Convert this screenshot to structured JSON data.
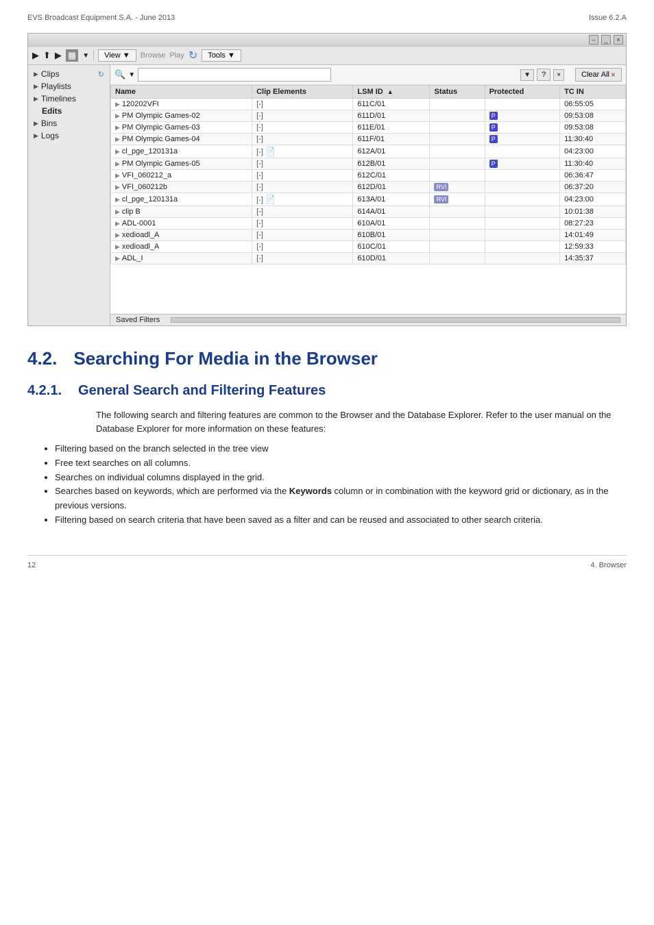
{
  "header": {
    "left": "EVS Broadcast Equipment S.A.  - June 2013",
    "right": "Issue 6.2.A"
  },
  "titleBar": {
    "minimize": "–",
    "restore": "_",
    "close": "×"
  },
  "toolbar": {
    "viewLabel": "View ▼",
    "browseLabel": "Browse",
    "playLabel": "Play",
    "toolsLabel": "Tools ▼",
    "refreshIcon": "↻"
  },
  "sidebar": {
    "items": [
      {
        "label": "Clips",
        "hasArrow": true,
        "icon": "↻",
        "bold": true
      },
      {
        "label": "Playlists",
        "hasArrow": true,
        "bold": true
      },
      {
        "label": "Timelines",
        "hasArrow": true,
        "bold": true
      },
      {
        "label": "Edits",
        "hasArrow": false,
        "indent": true,
        "bold": true
      },
      {
        "label": "Bins",
        "hasArrow": true,
        "bold": true
      },
      {
        "label": "Logs",
        "hasArrow": true,
        "bold": true
      }
    ]
  },
  "searchBar": {
    "placeholder": "",
    "searchIcon": "🔍",
    "dropdownIcon": "▼",
    "helpIcon": "?",
    "clearIcon": "×",
    "clearAllLabel": "Clear All",
    "clearAllIcon": "×"
  },
  "table": {
    "columns": [
      "Name",
      "Clip Elements",
      "LSM ID",
      "Status",
      "Protected",
      "TC IN"
    ],
    "sortCol": "LSM ID",
    "sortDir": "▲",
    "rows": [
      {
        "name": "120202VFI",
        "clipElem": "[-]",
        "lsmId": "611C/01",
        "status": "",
        "protected": "",
        "tcIn": "06:55:05"
      },
      {
        "name": "PM Olympic Games-02",
        "clipElem": "[-]",
        "lsmId": "611D/01",
        "status": "",
        "protected": "P",
        "tcIn": "09:53:08"
      },
      {
        "name": "PM Olympic Games-03",
        "clipElem": "[-]",
        "lsmId": "611E/01",
        "status": "",
        "protected": "P",
        "tcIn": "09:53:08"
      },
      {
        "name": "PM Olympic Games-04",
        "clipElem": "[-]",
        "lsmId": "611F/01",
        "status": "",
        "protected": "P",
        "tcIn": "11:30:40"
      },
      {
        "name": "cl_pge_120131a",
        "clipElem": "[-]",
        "lsmId": "612A/01",
        "status": "",
        "protected": "",
        "tcIn": "04:23:00",
        "hasFileIcon": true
      },
      {
        "name": "PM Olympic Games-05",
        "clipElem": "[-]",
        "lsmId": "612B/01",
        "status": "",
        "protected": "P",
        "tcIn": "11:30:40"
      },
      {
        "name": "VFI_060212_a",
        "clipElem": "[-]",
        "lsmId": "612C/01",
        "status": "",
        "protected": "",
        "tcIn": "06:36:47"
      },
      {
        "name": "VFI_060212b",
        "clipElem": "[-]",
        "lsmId": "612D/01",
        "status": "RVI",
        "protected": "",
        "tcIn": "06:37:20"
      },
      {
        "name": "cl_pge_120131a",
        "clipElem": "[-]",
        "lsmId": "613A/01",
        "status": "RVI",
        "protected": "",
        "tcIn": "04:23:00",
        "hasFileIcon": true
      },
      {
        "name": "clip B",
        "clipElem": "[-]",
        "lsmId": "614A/01",
        "status": "",
        "protected": "",
        "tcIn": "10:01:38"
      },
      {
        "name": "ADL-0001",
        "clipElem": "[-]",
        "lsmId": "610A/01",
        "status": "",
        "protected": "",
        "tcIn": "08:27:23"
      },
      {
        "name": "xedioadl_A",
        "clipElem": "[-]",
        "lsmId": "610B/01",
        "status": "",
        "protected": "",
        "tcIn": "14:01:49"
      },
      {
        "name": "xedioadl_A",
        "clipElem": "[-]",
        "lsmId": "610C/01",
        "status": "",
        "protected": "",
        "tcIn": "12:59:33"
      },
      {
        "name": "ADL_I",
        "clipElem": "[-]",
        "lsmId": "610D/01",
        "status": "",
        "protected": "",
        "tcIn": "14:35:37"
      }
    ]
  },
  "bottomBar": {
    "label": "Saved Filters"
  },
  "section42": {
    "num": "4.2.",
    "title": "Searching For Media in the Browser"
  },
  "section421": {
    "num": "4.2.1.",
    "title": "General Search and Filtering Features"
  },
  "bodyText": "The following search and filtering features are common to the Browser and the Database Explorer. Refer to the user manual on the Database Explorer for more information on these features:",
  "bullets": [
    "Filtering based on the branch selected in the tree view",
    "Free text searches on all columns.",
    "Searches on individual columns displayed in the grid.",
    "Searches based on keywords, which are performed via the Keywords column or in combination with the keyword grid or dictionary, as in the previous versions.",
    "Filtering based on search criteria that have been saved as a filter and can be reused and associated to other search criteria."
  ],
  "bulletKeyword": "Keywords",
  "footer": {
    "left": "12",
    "right": "4. Browser"
  }
}
